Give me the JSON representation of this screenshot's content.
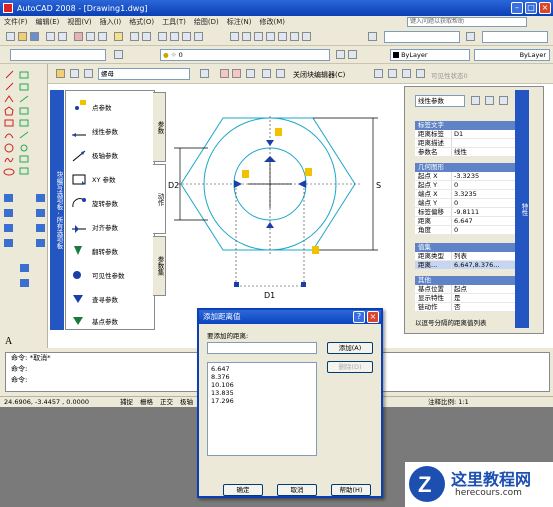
{
  "title_bar": {
    "app": "AutoCAD 2008",
    "file": "- [Drawing1.dwg]"
  },
  "menu": {
    "items": [
      "文件(F)",
      "编辑(E)",
      "视图(V)",
      "插入(I)",
      "格式(O)",
      "工具(T)",
      "绘图(D)",
      "标注(N)",
      "修改(M)"
    ],
    "help_placeholder": "键入问题以获取帮助"
  },
  "toolbars": {
    "layer_value": "0",
    "bylayer_color": "ByLayer",
    "bylayer_linetype": "ByLayer",
    "block_editor_name": "螺母",
    "close_block_editor": "关闭块编辑器(C)",
    "visibility_state": "可见性状态0"
  },
  "block_palette": {
    "side_label": "块编写选项板 - 所有选项板",
    "items": [
      "点参数",
      "线性参数",
      "极轴参数",
      "XY 参数",
      "旋转参数",
      "对齐参数",
      "翻转参数",
      "可见性参数",
      "查寻参数",
      "基点参数"
    ],
    "tabs": [
      "参数",
      "动作",
      "参数集"
    ]
  },
  "properties": {
    "selector": "线性参数",
    "side_label": "特性",
    "sections": {
      "param_label": "标签文字",
      "geometry": "几何图形",
      "values": "值集",
      "misc": "其他"
    },
    "rows": [
      {
        "k": "距离标签",
        "v": "D1"
      },
      {
        "k": "距离描述",
        "v": ""
      },
      {
        "k": "参数名",
        "v": "线性"
      },
      {
        "k": "起点 X",
        "v": "-3.3235"
      },
      {
        "k": "起点 Y",
        "v": "0"
      },
      {
        "k": "端点 X",
        "v": "3.3235"
      },
      {
        "k": "端点 Y",
        "v": "0"
      },
      {
        "k": "标签偏移",
        "v": "-9.8111"
      },
      {
        "k": "距离",
        "v": "6.647"
      },
      {
        "k": "角度",
        "v": "0"
      },
      {
        "k": "距离类型",
        "v": "列表"
      },
      {
        "k": "距离...",
        "v": "6.647,8.376..."
      },
      {
        "k": "基点位置",
        "v": "起点"
      },
      {
        "k": "显示特性",
        "v": "是"
      },
      {
        "k": "链动作",
        "v": "否"
      }
    ],
    "note": "以逗号分隔的距离值列表"
  },
  "drawing": {
    "labels": {
      "d1": "D1",
      "d2": "D2",
      "dimv": "S",
      "center": "中"
    }
  },
  "command": {
    "lines": [
      "命令: *取消*",
      "命令:",
      "命令:"
    ]
  },
  "status": {
    "coords": "24.6906, -3.4457 , 0.0000",
    "modes": [
      "捕捉",
      "栅格",
      "正交",
      "极轴"
    ],
    "scale": "注释比例: 1:1"
  },
  "dialog": {
    "title": "添加距离值",
    "prompt": "要添加的距离:",
    "add": "添加(A)",
    "delete": "删除(D)",
    "values": [
      "6.647",
      "8.376",
      "10.106",
      "13.835",
      "17.296"
    ],
    "ok": "确定",
    "cancel": "取消",
    "help": "帮助(H)"
  },
  "watermark": {
    "cn": "这里教程网",
    "url": "herecours.com"
  }
}
